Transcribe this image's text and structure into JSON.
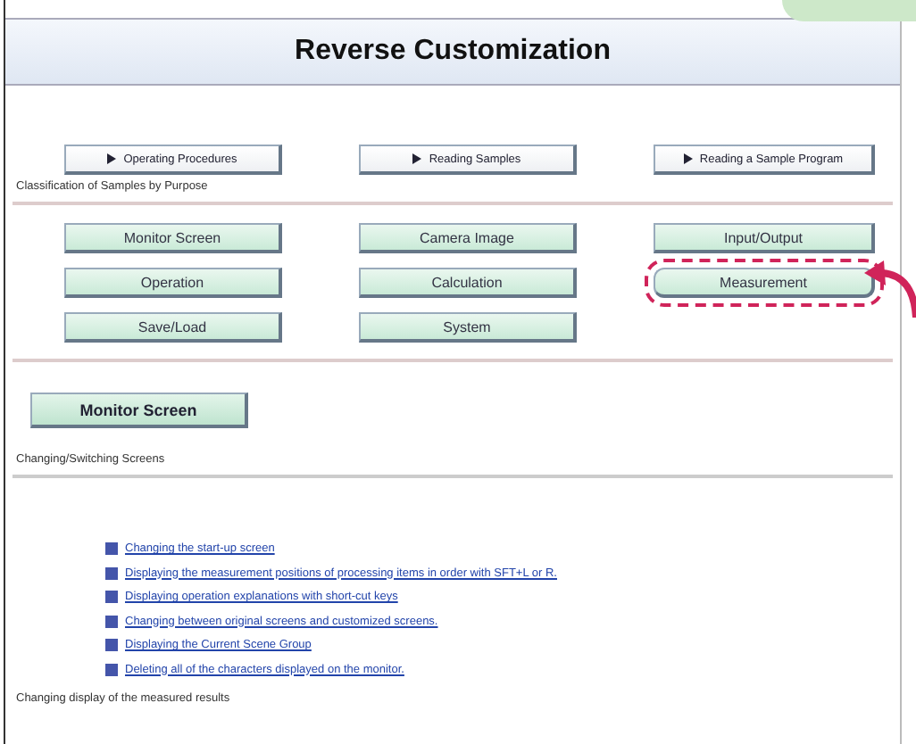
{
  "window": {
    "title": "Reverse Customization"
  },
  "nav_buttons": [
    {
      "label": "Operating Procedures"
    },
    {
      "label": "Reading Samples"
    },
    {
      "label": "Reading a Sample Program"
    }
  ],
  "classification_label": "Classification of Samples by Purpose",
  "category_buttons": [
    {
      "label": "Monitor Screen",
      "highlighted": false
    },
    {
      "label": "Camera Image",
      "highlighted": false
    },
    {
      "label": "Input/Output",
      "highlighted": false
    },
    {
      "label": "Operation",
      "highlighted": false
    },
    {
      "label": "Calculation",
      "highlighted": false
    },
    {
      "label": "Measurement",
      "highlighted": true
    },
    {
      "label": "Save/Load",
      "highlighted": false
    },
    {
      "label": "System",
      "highlighted": false
    }
  ],
  "section_button": {
    "label": "Monitor Screen"
  },
  "section_heading": "Changing/Switching Screens",
  "links": [
    "Changing the start-up screen",
    "Displaying the measurement positions of processing items in order with SFT+L or R.",
    "Displaying operation explanations with short-cut keys",
    "Changing between original screens and customized screens.",
    "Displaying the Current Scene Group",
    "Deleting all of the characters displayed on the monitor."
  ],
  "footer_text": "Changing display of the measured results"
}
